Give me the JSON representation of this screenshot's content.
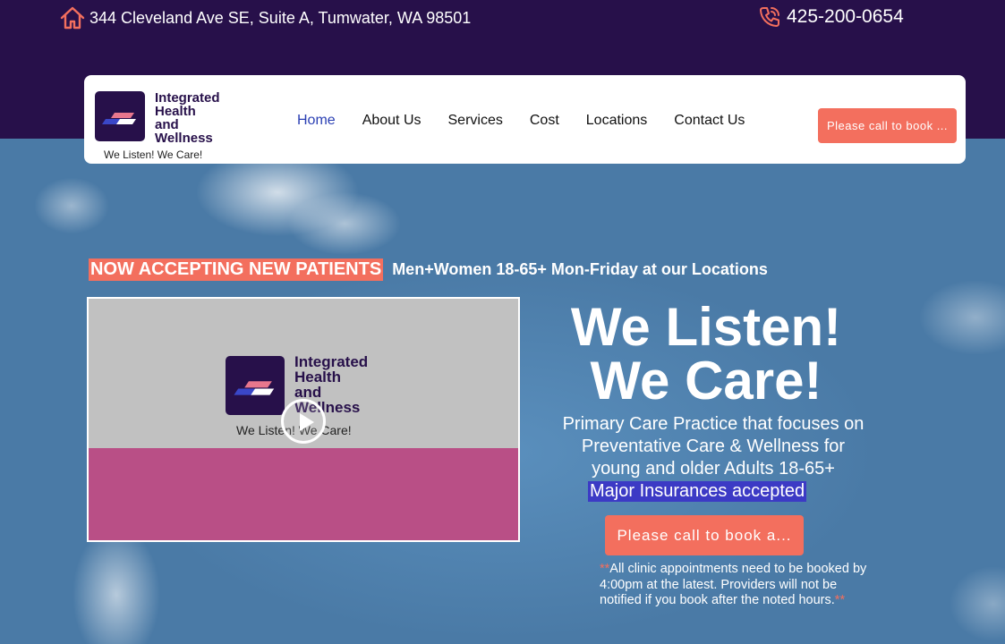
{
  "topbar": {
    "address": "344 Cleveland Ave SE, Suite A, Tumwater, WA 98501",
    "address_icon": "home-icon",
    "phone": "425-200-0654",
    "phone_icon": "phone-icon"
  },
  "logo": {
    "name_line1": "Integrated",
    "name_line2": "Health",
    "name_line3": "and",
    "name_line4": "Wellness",
    "tagline": "We Listen! We Care!"
  },
  "nav": {
    "items": [
      {
        "label": "Home",
        "active": true
      },
      {
        "label": "About Us"
      },
      {
        "label": "Services"
      },
      {
        "label": "Cost"
      },
      {
        "label": "Locations"
      },
      {
        "label": "Contact Us"
      }
    ],
    "book_button": "Please call to book ..."
  },
  "banner": {
    "highlight": "NOW ACCEPTING NEW PATIENTS",
    "detail": "Men+Women 18-65+ Mon-Friday at our Locations"
  },
  "video": {
    "logo_line1": "Integrated",
    "logo_line2": "Health",
    "logo_line3": "and",
    "logo_line4": "Wellness",
    "tagline": "We Listen! We Care!",
    "play_icon": "play-icon"
  },
  "hero": {
    "title_line1": "We Listen!",
    "title_line2": "We Care!",
    "description_line1": "Primary Care Practice that focuses on",
    "description_line2": "Preventative Care & Wellness for",
    "description_line3": "young and older Adults 18-65+",
    "insurance": "Major Insurances accepted",
    "book_button": "Please call to book a...",
    "note_prefix": "**",
    "note_text": "All clinic appointments need to be booked by 4:00pm at the latest. Providers will not be notified if you book after the noted hours.",
    "note_suffix": "**"
  },
  "colors": {
    "topbar_bg": "#27104a",
    "accent_coral": "#f36f5e",
    "nav_active": "#2a3fb3",
    "insurance_highlight": "#3c3ac5",
    "video_pink": "#b94f86"
  }
}
